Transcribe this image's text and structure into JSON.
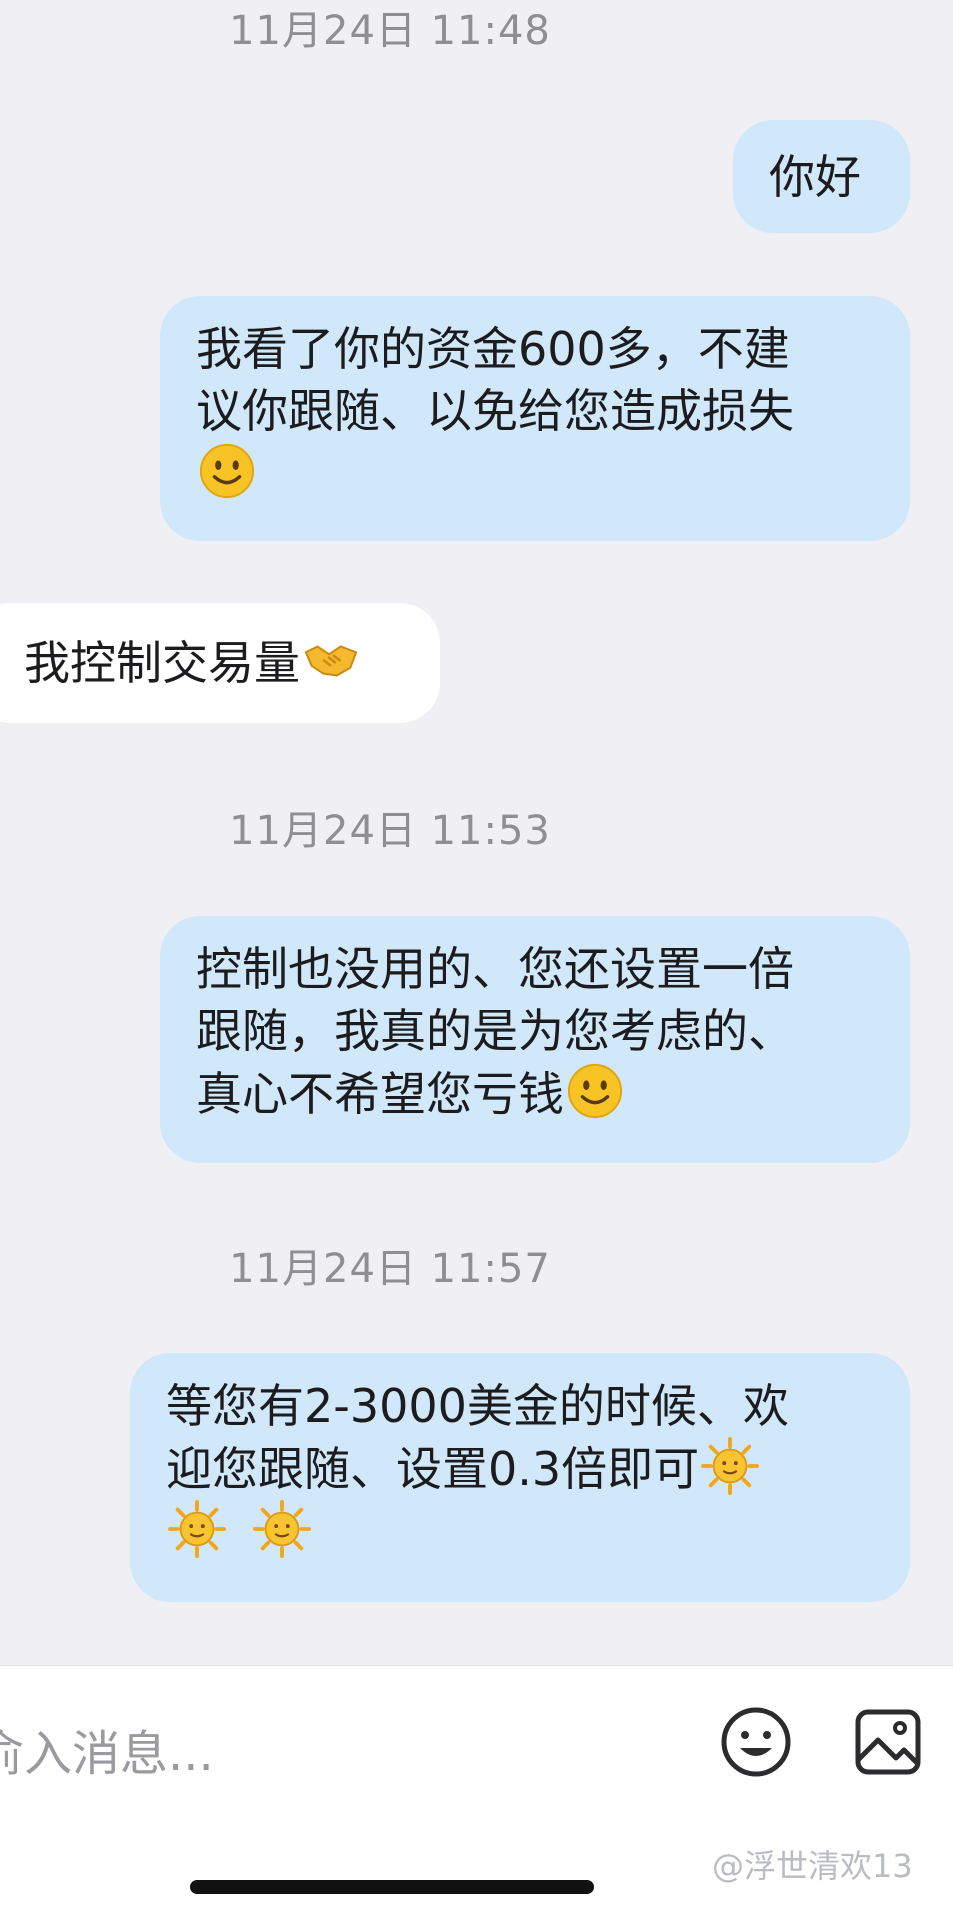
{
  "timestamps": [
    "11月24日 11:48",
    "11月24日 11:53",
    "11月24日 11:57"
  ],
  "messages": [
    {
      "side": "out",
      "text": "你好"
    },
    {
      "side": "out",
      "line1": "我看了你的资金600多，不建",
      "line2": "议你跟随、以免给您造成损失",
      "emoji": "slightly-smiling-face"
    },
    {
      "side": "in",
      "text": "我控制交易量",
      "emoji": "handshake"
    },
    {
      "side": "out",
      "line1": "控制也没用的、您还设置一倍",
      "line2": "跟随，我真的是为您考虑的、",
      "line3": "真心不希望您亏钱",
      "emoji": "slightly-smiling-face"
    },
    {
      "side": "out",
      "line1": "等您有2-3000美金的时候、欢",
      "line2": "迎您跟随、设置0.3倍即可",
      "emoji": "sun-with-face",
      "emoji_count": 3
    }
  ],
  "input": {
    "placeholder": "输入消息...",
    "visible_placeholder": "俞入消息..."
  },
  "icons": {
    "emoji_button": "smiley-face-icon",
    "image_button": "image-icon"
  },
  "watermark": "@浮世清欢13",
  "colors": {
    "outgoing_bubble": "#d1e8fb",
    "incoming_bubble": "#ffffff",
    "background": "#efeff4"
  }
}
